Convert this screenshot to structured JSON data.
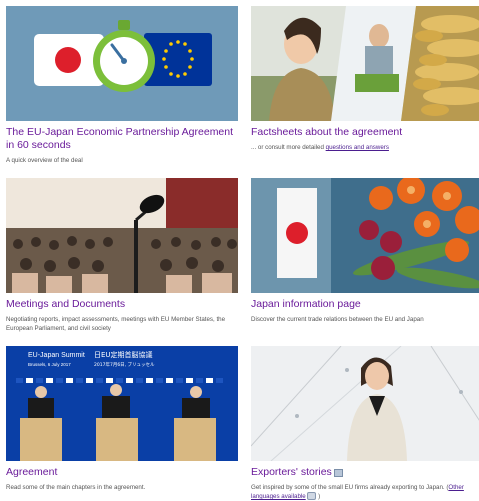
{
  "cards": [
    {
      "title": "The EU-Japan Economic Partnership Agreement in 60 seconds",
      "desc": "A quick overview of the deal"
    },
    {
      "title": "Factsheets about the agreement",
      "desc_prefix": "... or consult more detailed ",
      "desc_link": "questions and answers"
    },
    {
      "title": "Meetings and Documents",
      "desc": "Negotiating reports, impact assessments, meetings with EU Member States, the European Parliament, and civil society"
    },
    {
      "title": "Japan information page",
      "desc": "Discover the current trade relations between the EU and Japan"
    },
    {
      "title": "Agreement",
      "desc": "Read some of the main chapters in the agreement.",
      "banner": {
        "title": "EU-Japan Summit",
        "jp_title": "日EU定期首脳協議",
        "place": "Brussels, 6 July 2017",
        "jp_place": "2017年7月6日, ブリュッセル"
      }
    },
    {
      "title": "Exporters' stories",
      "desc_prefix": "Get inspired by some of the small EU firms already exporting to Japan. (",
      "desc_link": "Other languages available",
      "desc_suffix": " )"
    }
  ],
  "colors": {
    "title": "#6a1b9a",
    "eu_blue": "#003399",
    "japan_red": "#dd1f2b",
    "timer_green": "#7cbf3a"
  },
  "icons": [
    "external-link-icon",
    "speech-bubble-icon"
  ]
}
